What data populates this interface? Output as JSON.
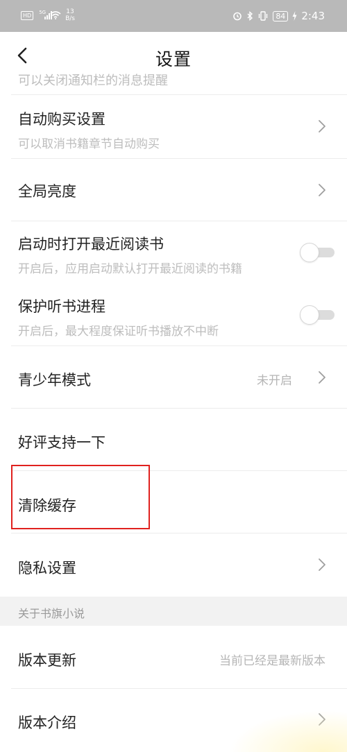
{
  "status_bar": {
    "hd": "HD",
    "signal_label": "5G",
    "speed_value": "13",
    "speed_unit": "B/s",
    "battery": "84",
    "time": "2:43"
  },
  "nav": {
    "title": "设置"
  },
  "clipped_row": {
    "subtitle": "可以关闭通知栏的消息提醒"
  },
  "items": {
    "auto_buy": {
      "title": "自动购买设置",
      "subtitle": "可以取消书籍章节自动购买"
    },
    "brightness": {
      "title": "全局亮度"
    },
    "open_recent": {
      "title": "启动时打开最近阅读书",
      "subtitle": "开启后，应用启动默认打开最近阅读的书籍",
      "enabled": false
    },
    "protect_listen": {
      "title": "保护听书进程",
      "subtitle": "开启后，最大程度保证听书播放不中断",
      "enabled": false
    },
    "youth_mode": {
      "title": "青少年模式",
      "value": "未开启"
    },
    "rate_us": {
      "title": "好评支持一下"
    },
    "clear_cache": {
      "title": "清除缓存"
    },
    "privacy": {
      "title": "隐私设置"
    }
  },
  "about_section": {
    "header": "关于书旗小说",
    "version_update": {
      "title": "版本更新",
      "value": "当前已经是最新版本"
    },
    "version_intro": {
      "title": "版本介绍"
    }
  },
  "colors": {
    "highlight_box": "#e0211e",
    "section_background": "#f2f2f2",
    "status_bar": "#b9b9b9"
  }
}
